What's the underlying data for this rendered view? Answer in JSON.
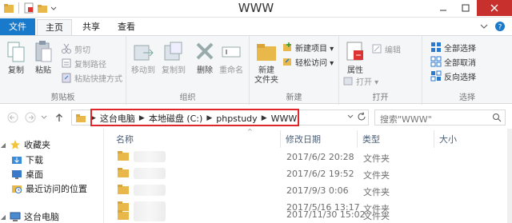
{
  "window": {
    "title": "WWW"
  },
  "tabs": {
    "file": "文件",
    "home": "主页",
    "share": "共享",
    "view": "查看"
  },
  "ribbon": {
    "clipboard": {
      "label": "剪贴板",
      "copy": "复制",
      "paste": "粘贴",
      "cut": "剪切",
      "copy_path": "复制路径",
      "paste_shortcut": "粘贴快捷方式"
    },
    "organize": {
      "label": "组织",
      "move_to": "移动到",
      "copy_to": "复制到",
      "delete": "删除",
      "rename": "重命名"
    },
    "new": {
      "label": "新建",
      "new_folder": "新建\n文件夹",
      "new_item": "新建项目 ▾",
      "easy_access": "轻松访问 ▾"
    },
    "open": {
      "label": "打开",
      "properties": "属性",
      "open": "打开 ▾",
      "edit": "编辑"
    },
    "select": {
      "label": "选择",
      "select_all": "全部选择",
      "select_none": "全部取消",
      "invert": "反向选择"
    }
  },
  "address": {
    "crumbs": [
      "这台电脑",
      "本地磁盘 (C:)",
      "phpstudy",
      "WWW"
    ],
    "search_placeholder": "搜索\"WWW\""
  },
  "navpane": {
    "items": [
      {
        "label": "收藏夹",
        "icon": "star-icon"
      },
      {
        "label": "下载",
        "icon": "download-folder-icon"
      },
      {
        "label": "桌面",
        "icon": "desktop-icon"
      },
      {
        "label": "最近访问的位置",
        "icon": "recent-places-icon"
      },
      {
        "label": "这台电脑",
        "icon": "computer-icon"
      }
    ]
  },
  "filelist": {
    "columns": {
      "name": "名称",
      "modified": "修改日期",
      "type": "类型",
      "size": "大小"
    },
    "rows": [
      {
        "modified": "2017/6/2 20:28",
        "type": "文件夹"
      },
      {
        "modified": "2017/6/2 19:52",
        "type": "文件夹"
      },
      {
        "modified": "2017/9/3 0:06",
        "type": "文件夹"
      },
      {
        "modified": "2017/5/16 13:17",
        "type": "文件夹"
      },
      {
        "modified": "2017/11/30 15:02",
        "type": "文件夹"
      }
    ]
  },
  "colors": {
    "accent": "#1979ca",
    "highlight": "#e0262b",
    "folder": "#e8b84a"
  }
}
